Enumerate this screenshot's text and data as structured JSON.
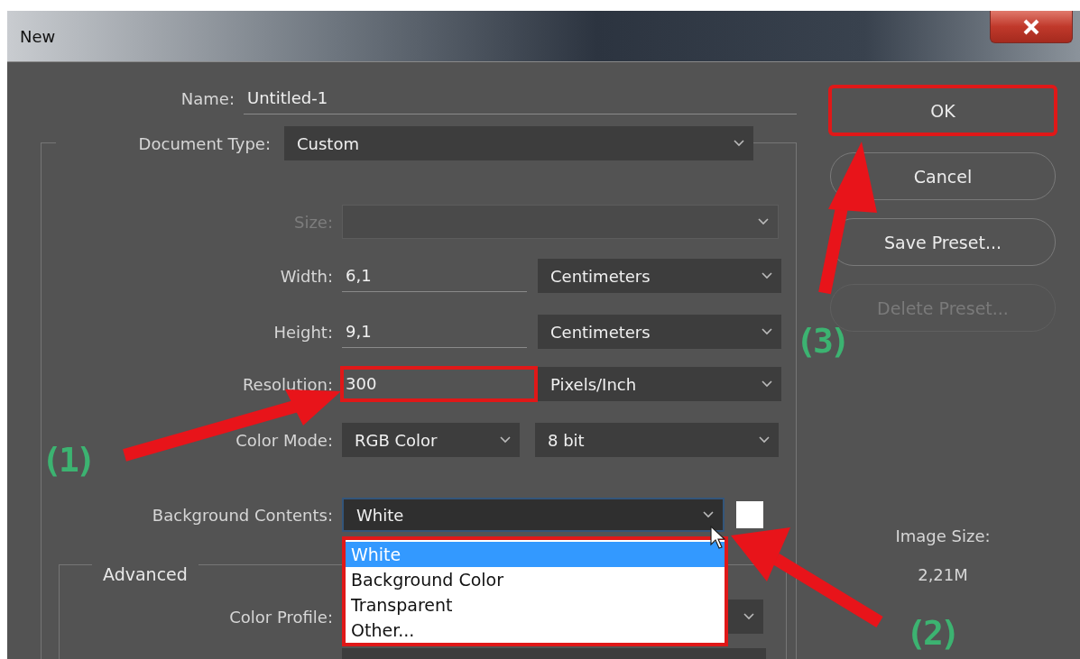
{
  "window": {
    "title": "New"
  },
  "name_field": {
    "label": "Name:",
    "value": "Untitled-1"
  },
  "document_type": {
    "label": "Document Type:",
    "value": "Custom"
  },
  "fields": [
    {
      "kind": "select",
      "label": "Size:",
      "disabled": true
    },
    {
      "kind": "measure",
      "label": "Width:",
      "value": "6,1",
      "unit": "Centimeters",
      "highlighted": false
    },
    {
      "kind": "measure",
      "label": "Height:",
      "value": "9,1",
      "unit": "Centimeters",
      "highlighted": false
    },
    {
      "kind": "measure",
      "label": "Resolution:",
      "value": "300",
      "unit": "Pixels/Inch",
      "highlighted": true
    },
    {
      "kind": "pair",
      "label": "Color Mode:",
      "value": "RGB Color",
      "unit": "8 bit"
    }
  ],
  "background_contents": {
    "label": "Background Contents:",
    "value": "White",
    "expanded": true,
    "options": [
      {
        "label": "White",
        "selected": true
      },
      {
        "label": "Background Color",
        "selected": false
      },
      {
        "label": "Transparent",
        "selected": false
      },
      {
        "label": "Other...",
        "selected": false
      }
    ]
  },
  "advanced": {
    "title": "Advanced",
    "color_profile": {
      "label": "Color Profile:"
    }
  },
  "buttons": [
    {
      "label": "OK",
      "disabled": false,
      "highlighted": true
    },
    {
      "label": "Cancel",
      "disabled": false,
      "highlighted": false
    },
    {
      "label": "Save Preset...",
      "disabled": false,
      "highlighted": false
    },
    {
      "label": "Delete Preset...",
      "disabled": true,
      "highlighted": false
    }
  ],
  "image_size": {
    "label": "Image Size:",
    "value": "2,21M"
  },
  "annotations": [
    {
      "label": "(1)"
    },
    {
      "label": "(2)"
    },
    {
      "label": "(3)"
    }
  ]
}
